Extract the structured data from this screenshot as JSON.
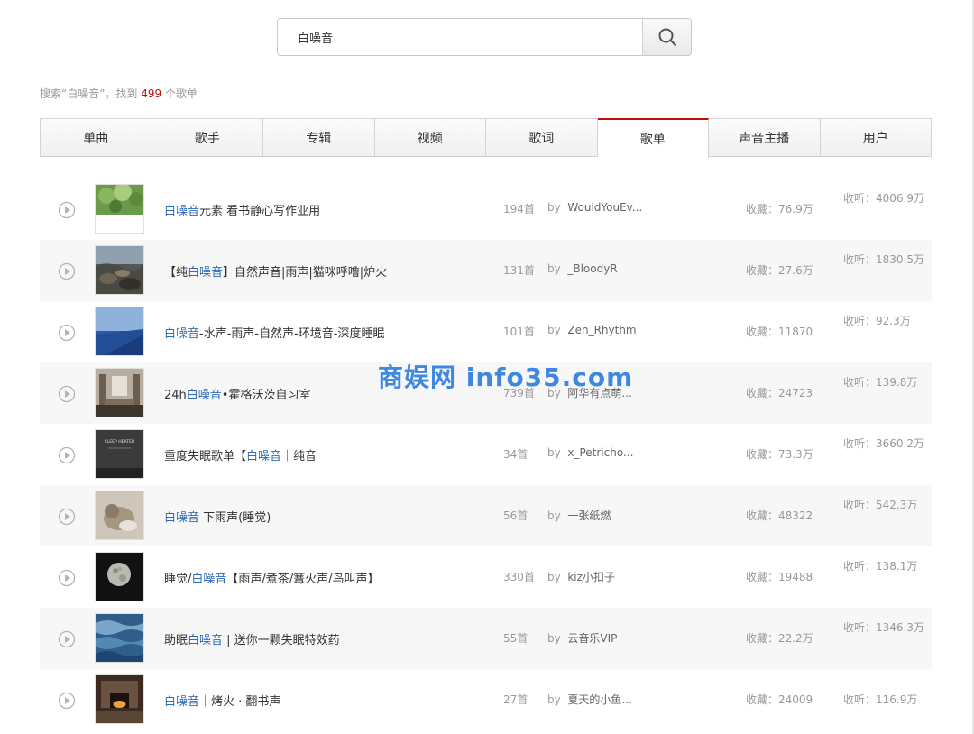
{
  "search": {
    "query": "白噪音"
  },
  "summary": {
    "prefix": "搜索“白噪音”，找到 ",
    "count": "499",
    "suffix": " 个歌单"
  },
  "tabs": [
    "单曲",
    "歌手",
    "专辑",
    "视频",
    "歌词",
    "歌单",
    "声音主播",
    "用户"
  ],
  "active_tab": "歌单",
  "playlists": [
    {
      "name_parts": [
        {
          "t": "白噪音",
          "hl": true
        },
        {
          "t": "元素 看书静心写作业用",
          "hl": false
        }
      ],
      "tracks": "194首",
      "by": "by",
      "creator": "WouldYouEv...",
      "fav": "收藏：76.9万",
      "plays": "收听：4006.9万",
      "cover": "forest"
    },
    {
      "name_parts": [
        {
          "t": "【纯",
          "hl": false
        },
        {
          "t": "白噪音",
          "hl": true
        },
        {
          "t": "】自然声音|雨声|猫咪呼噜|炉火",
          "hl": false
        }
      ],
      "tracks": "131首",
      "by": "by",
      "creator": "_BloodyR",
      "fav": "收藏：27.6万",
      "plays": "收听：1830.5万",
      "cover": "rocks"
    },
    {
      "name_parts": [
        {
          "t": "白噪音",
          "hl": true
        },
        {
          "t": "-水声-雨声-自然声-环境音-深度睡眠",
          "hl": false
        }
      ],
      "tracks": "101首",
      "by": "by",
      "creator": "Zen_Rhythm",
      "fav": "收藏：11870",
      "plays": "收听：92.3万",
      "cover": "ocean"
    },
    {
      "name_parts": [
        {
          "t": "24h",
          "hl": false
        },
        {
          "t": "白噪音",
          "hl": true
        },
        {
          "t": "•霍格沃茨自习室",
          "hl": false
        }
      ],
      "tracks": "739首",
      "by": "by",
      "creator": "阿华有点萌...",
      "fav": "收藏：24723",
      "plays": "收听：139.8万",
      "cover": "hall"
    },
    {
      "name_parts": [
        {
          "t": "重度失眠歌单【",
          "hl": false
        },
        {
          "t": "白噪音",
          "hl": true
        },
        {
          "t": "｜纯音",
          "hl": false
        }
      ],
      "tracks": "34首",
      "by": "by",
      "creator": "x_Petricho...",
      "fav": "收藏：73.3万",
      "plays": "收听：3660.2万",
      "cover": "sleep",
      "cover_text": "SLEEP HEATER"
    },
    {
      "name_parts": [
        {
          "t": "白噪音",
          "hl": true
        },
        {
          "t": " 下雨声(睡觉)",
          "hl": false
        }
      ],
      "tracks": "56首",
      "by": "by",
      "creator": "一张纸燃",
      "fav": "收藏：48322",
      "plays": "收听：542.3万",
      "cover": "cat"
    },
    {
      "name_parts": [
        {
          "t": "睡觉/",
          "hl": false
        },
        {
          "t": "白噪音",
          "hl": true
        },
        {
          "t": "【雨声/煮茶/篝火声/鸟叫声】",
          "hl": false
        }
      ],
      "tracks": "330首",
      "by": "by",
      "creator": "kiz小扣子",
      "fav": "收藏：19488",
      "plays": "收听：138.1万",
      "cover": "moon"
    },
    {
      "name_parts": [
        {
          "t": "助眠",
          "hl": false
        },
        {
          "t": "白噪音",
          "hl": true
        },
        {
          "t": " | 送你一颗失眠特效药",
          "hl": false
        }
      ],
      "tracks": "55首",
      "by": "by",
      "creator": "云音乐VIP",
      "fav": "收藏：22.2万",
      "plays": "收听：1346.3万",
      "cover": "water"
    },
    {
      "name_parts": [
        {
          "t": "白噪音",
          "hl": true
        },
        {
          "t": "｜烤火 · 翻书声",
          "hl": false
        }
      ],
      "tracks": "27首",
      "by": "by",
      "creator": "夏天的小鱼...",
      "fav": "收藏：24009",
      "plays": "收听：116.9万",
      "cover": "fire",
      "plays_oneline": true
    }
  ],
  "watermark": "商娱网 info35.com"
}
